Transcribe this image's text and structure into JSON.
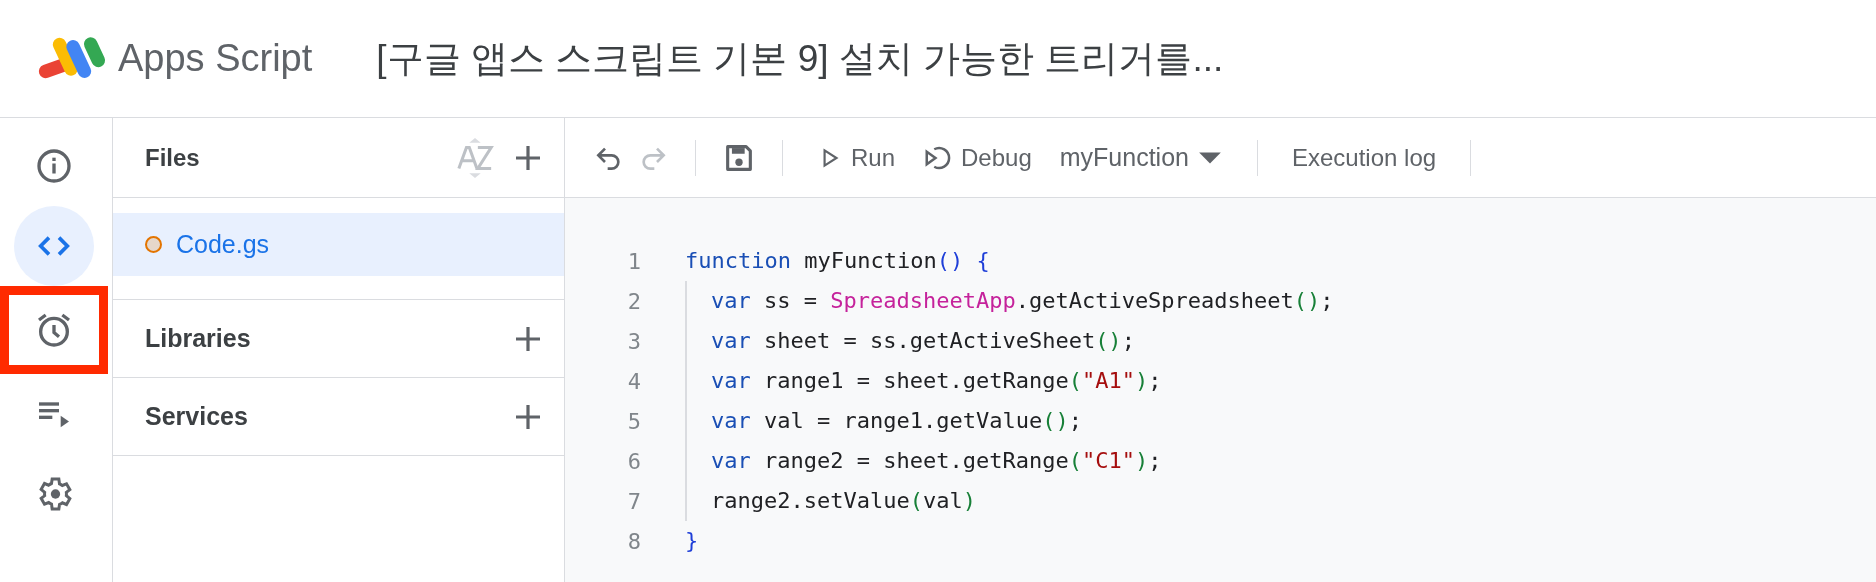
{
  "header": {
    "app_name": "Apps Script",
    "project_title": "[구글 앱스 스크립트 기본 9] 설치 가능한 트리거를..."
  },
  "rail": [
    {
      "kind": "info",
      "selected": false,
      "highlighted": false
    },
    {
      "kind": "code",
      "selected": true,
      "highlighted": false
    },
    {
      "kind": "triggers",
      "selected": false,
      "highlighted": true
    },
    {
      "kind": "executions",
      "selected": false,
      "highlighted": false
    },
    {
      "kind": "settings",
      "selected": false,
      "highlighted": false
    }
  ],
  "files_panel": {
    "title": "Files",
    "files": [
      {
        "name": "Code.gs",
        "selected": true,
        "color": "#e37400"
      }
    ],
    "sections": [
      {
        "title": "Libraries"
      },
      {
        "title": "Services"
      }
    ]
  },
  "toolbar": {
    "undo_disabled": false,
    "redo_disabled": true,
    "run": "Run",
    "debug": "Debug",
    "function": "myFunction",
    "execution_log": "Execution log"
  },
  "editor": {
    "lines": [
      {
        "number": "1",
        "guide": false,
        "tokens": [
          {
            "kind": "keyword",
            "text": "function"
          },
          {
            "kind": "plain",
            "text": " myFunction"
          },
          {
            "kind": "bracket",
            "text": "()"
          },
          {
            "kind": "bracket",
            "text": " {"
          }
        ]
      },
      {
        "number": "2",
        "guide": true,
        "tokens": [
          {
            "kind": "keyword",
            "text": "var"
          },
          {
            "kind": "plain",
            "text": " ss = "
          },
          {
            "kind": "class",
            "text": "SpreadsheetApp"
          },
          {
            "kind": "plain",
            "text": ".getActiveSpreadsheet"
          },
          {
            "kind": "paren",
            "text": "()"
          },
          {
            "kind": "plain",
            "text": ";"
          }
        ]
      },
      {
        "number": "3",
        "guide": true,
        "tokens": [
          {
            "kind": "keyword",
            "text": "var"
          },
          {
            "kind": "plain",
            "text": " sheet = ss.getActiveSheet"
          },
          {
            "kind": "paren",
            "text": "()"
          },
          {
            "kind": "plain",
            "text": ";"
          }
        ]
      },
      {
        "number": "4",
        "guide": true,
        "tokens": [
          {
            "kind": "keyword",
            "text": "var"
          },
          {
            "kind": "plain",
            "text": " range1 = sheet.getRange"
          },
          {
            "kind": "paren",
            "text": "("
          },
          {
            "kind": "string",
            "text": "\"A1\""
          },
          {
            "kind": "paren",
            "text": ")"
          },
          {
            "kind": "plain",
            "text": ";"
          }
        ]
      },
      {
        "number": "5",
        "guide": true,
        "tokens": [
          {
            "kind": "keyword",
            "text": "var"
          },
          {
            "kind": "plain",
            "text": " val = range1.getValue"
          },
          {
            "kind": "paren",
            "text": "()"
          },
          {
            "kind": "plain",
            "text": ";"
          }
        ]
      },
      {
        "number": "6",
        "guide": true,
        "tokens": [
          {
            "kind": "keyword",
            "text": "var"
          },
          {
            "kind": "plain",
            "text": " range2 = sheet.getRange"
          },
          {
            "kind": "paren",
            "text": "("
          },
          {
            "kind": "string",
            "text": "\"C1\""
          },
          {
            "kind": "paren",
            "text": ")"
          },
          {
            "kind": "plain",
            "text": ";"
          }
        ]
      },
      {
        "number": "7",
        "guide": true,
        "tokens": [
          {
            "kind": "plain",
            "text": "range2.setValue"
          },
          {
            "kind": "paren",
            "text": "("
          },
          {
            "kind": "plain",
            "text": "val"
          },
          {
            "kind": "paren",
            "text": ")"
          }
        ]
      },
      {
        "number": "8",
        "guide": false,
        "tokens": [
          {
            "kind": "bracket",
            "text": "}"
          }
        ]
      }
    ]
  }
}
